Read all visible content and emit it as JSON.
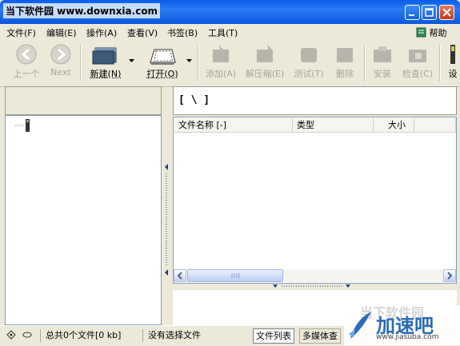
{
  "window": {
    "watermark_text": "当下软件园 www.downxia.com"
  },
  "menu": {
    "items": [
      "文件(F)",
      "编辑(E)",
      "操作(A)",
      "查看(V)",
      "书签(B)",
      "工具(T)"
    ],
    "help": "帮助(H)"
  },
  "toolbar": {
    "prev": "上一个",
    "next": "Next",
    "new": "新建(N)",
    "open": "打开(O)",
    "add": "添加(A)",
    "extract": "解压缩(E)",
    "test": "测试(T)",
    "delete": "删除",
    "install": "安装",
    "check": "检查(C)",
    "more": "设"
  },
  "path": {
    "current": "[ \\ ]"
  },
  "filelist": {
    "columns": [
      "文件名称 [-]",
      "类型",
      "大小"
    ]
  },
  "status": {
    "total": "总共0个文件[0 kb]",
    "selected": "没有选择文件",
    "tab_list": "文件列表",
    "tab_media": "多媒体查"
  },
  "corner_watermark": {
    "text": "加速吧",
    "url": "www.jiasuba.com",
    "ghost": "当下软件园"
  },
  "colors": {
    "titlebar": "#0a5ee8",
    "toolbar_bg": "#ece9d8",
    "brand_blue": "#2a6bb8"
  }
}
